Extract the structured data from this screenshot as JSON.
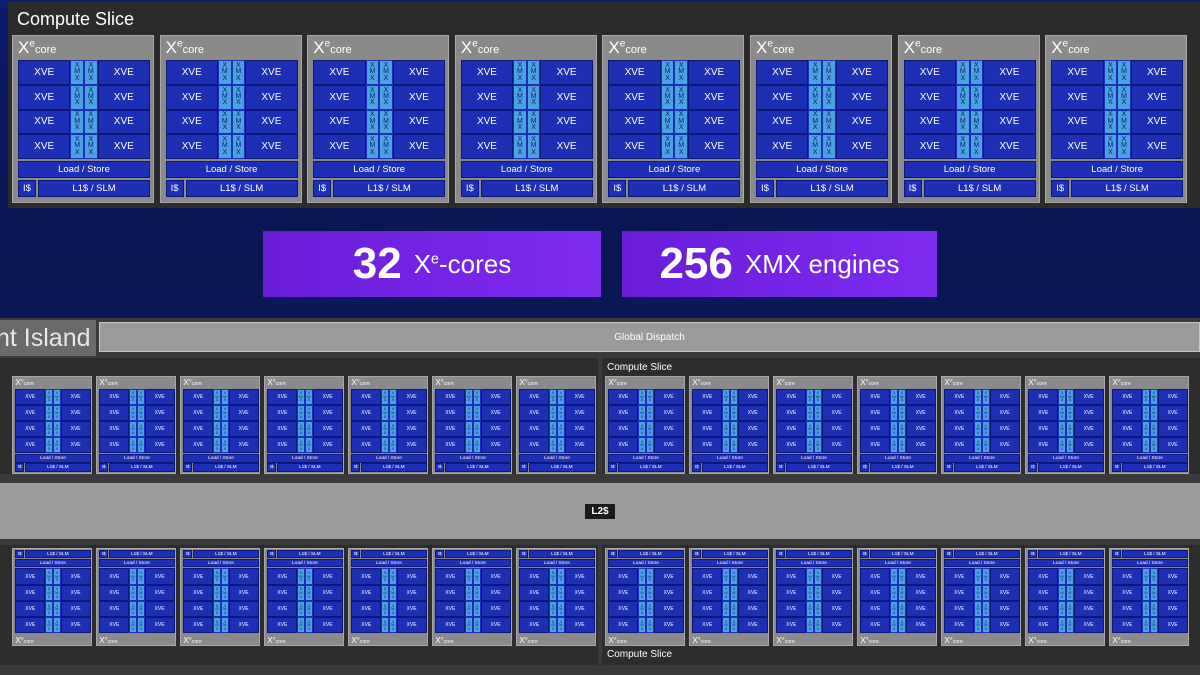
{
  "top_slice": {
    "title": "Compute Slice",
    "core_count": 8
  },
  "core": {
    "xe_base": "X",
    "xe_sup": "e",
    "xe_suffix": "core",
    "xve_label": "XVE",
    "xmx_letters": [
      "X",
      "M",
      "X"
    ],
    "load_store": "Load / Store",
    "is": "I$",
    "l1": "L1$ / SLM"
  },
  "stats": {
    "cores_number": "32",
    "cores_base": "X",
    "cores_sup": "e",
    "cores_suffix": "-cores",
    "xmx_number": "256",
    "xmx_label": "XMX engines"
  },
  "island": {
    "title": "nt Island",
    "dispatch": "Global Dispatch",
    "l2": "L2$",
    "slice_label_top": "Compute Slice",
    "slice_label_bottom": "Compute Slice"
  },
  "colors": {
    "xve": "#1d2fb4",
    "xmx": "#4aa3e0",
    "banner": "#7d2cf0",
    "core_bg": "#8a8a8a"
  }
}
